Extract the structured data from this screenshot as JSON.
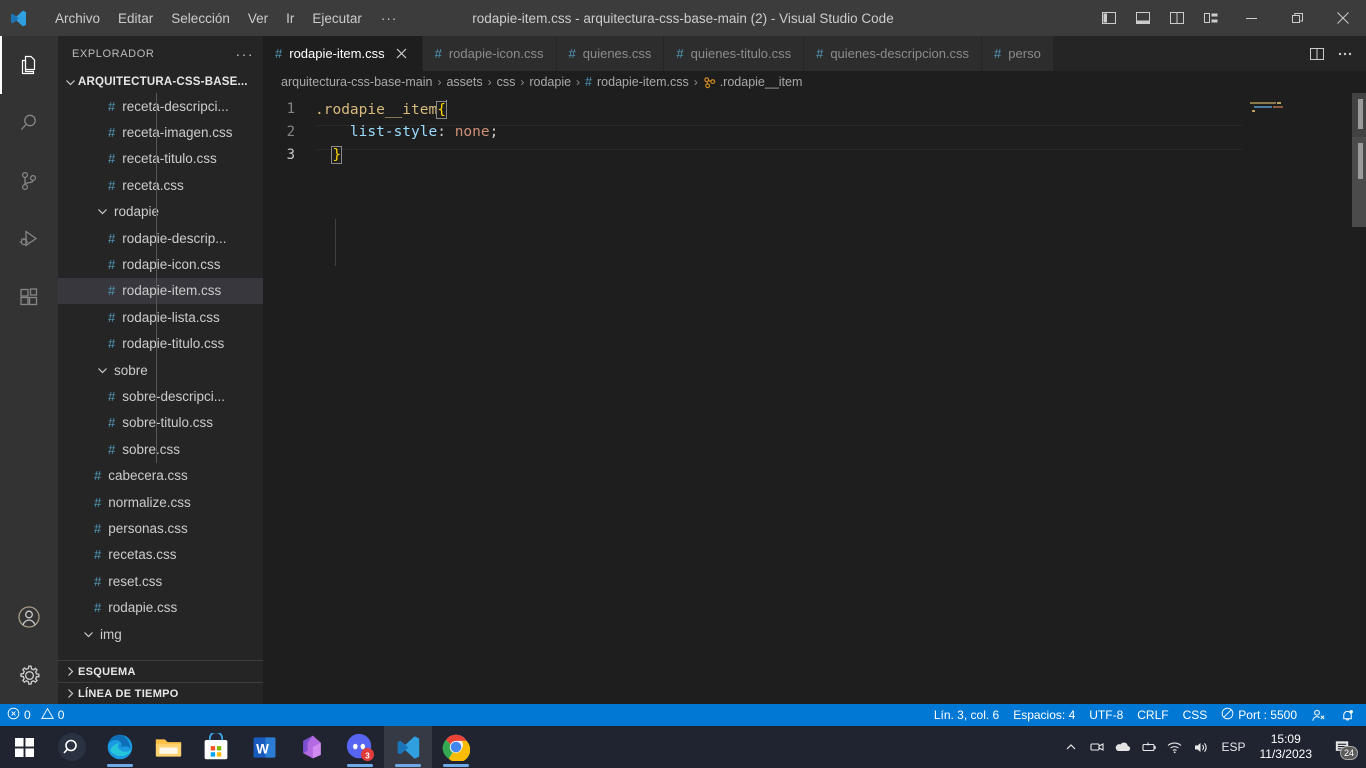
{
  "titlebar": {
    "logo_icon": "vscode-logo-icon",
    "menus": [
      "Archivo",
      "Editar",
      "Selección",
      "Ver",
      "Ir",
      "Ejecutar",
      "···"
    ],
    "title": "rodapie-item.css - arquitectura-css-base-main (2) - Visual Studio Code",
    "layout_icons": [
      "toggle-primary-sidebar-icon",
      "toggle-panel-icon",
      "toggle-secondary-sidebar-icon",
      "customize-layout-icon"
    ],
    "window_controls": [
      "minimize-button",
      "restore-button",
      "close-button"
    ]
  },
  "activitybar": {
    "items": [
      {
        "name": "explorer",
        "icon": "files-icon",
        "active": true
      },
      {
        "name": "search",
        "icon": "search-icon",
        "active": false
      },
      {
        "name": "source-control",
        "icon": "source-control-icon",
        "active": false
      },
      {
        "name": "run-and-debug",
        "icon": "run-debug-icon",
        "active": false
      },
      {
        "name": "extensions",
        "icon": "extensions-icon",
        "active": false
      }
    ],
    "bottom": [
      {
        "name": "accounts",
        "icon": "account-icon"
      },
      {
        "name": "manage-settings",
        "icon": "gear-icon"
      }
    ]
  },
  "sidebar": {
    "title": "EXPLORADOR",
    "more_actions": "···",
    "root_folder": "ARQUITECTURA-CSS-BASE...",
    "tree": [
      {
        "label": "receta-descripci...",
        "type": "file",
        "indent": 3,
        "selected": false
      },
      {
        "label": "receta-imagen.css",
        "type": "file",
        "indent": 3,
        "selected": false
      },
      {
        "label": "receta-titulo.css",
        "type": "file",
        "indent": 3,
        "selected": false
      },
      {
        "label": "receta.css",
        "type": "file",
        "indent": 3,
        "selected": false
      },
      {
        "label": "rodapie",
        "type": "folder-open",
        "indent": 2,
        "selected": false
      },
      {
        "label": "rodapie-descrip...",
        "type": "file",
        "indent": 3,
        "selected": false
      },
      {
        "label": "rodapie-icon.css",
        "type": "file",
        "indent": 3,
        "selected": false
      },
      {
        "label": "rodapie-item.css",
        "type": "file",
        "indent": 3,
        "selected": true
      },
      {
        "label": "rodapie-lista.css",
        "type": "file",
        "indent": 3,
        "selected": false
      },
      {
        "label": "rodapie-titulo.css",
        "type": "file",
        "indent": 3,
        "selected": false
      },
      {
        "label": "sobre",
        "type": "folder-open",
        "indent": 2,
        "selected": false
      },
      {
        "label": "sobre-descripci...",
        "type": "file",
        "indent": 3,
        "selected": false
      },
      {
        "label": "sobre-titulo.css",
        "type": "file",
        "indent": 3,
        "selected": false
      },
      {
        "label": "sobre.css",
        "type": "file",
        "indent": 3,
        "selected": false
      },
      {
        "label": "cabecera.css",
        "type": "file",
        "indent": 2,
        "selected": false
      },
      {
        "label": "normalize.css",
        "type": "file",
        "indent": 2,
        "selected": false
      },
      {
        "label": "personas.css",
        "type": "file",
        "indent": 2,
        "selected": false
      },
      {
        "label": "recetas.css",
        "type": "file",
        "indent": 2,
        "selected": false
      },
      {
        "label": "reset.css",
        "type": "file",
        "indent": 2,
        "selected": false
      },
      {
        "label": "rodapie.css",
        "type": "file",
        "indent": 2,
        "selected": false
      },
      {
        "label": "img",
        "type": "folder-open",
        "indent": 1,
        "selected": false
      }
    ],
    "panels": [
      {
        "label": "ESQUEMA",
        "collapsed": true
      },
      {
        "label": "LÍNEA DE TIEMPO",
        "collapsed": true
      }
    ]
  },
  "editor": {
    "tabs": [
      {
        "label": "rodapie-item.css",
        "icon": "css-file-icon",
        "active": true,
        "closable": true
      },
      {
        "label": "rodapie-icon.css",
        "icon": "css-file-icon",
        "active": false,
        "closable": false
      },
      {
        "label": "quienes.css",
        "icon": "css-file-icon",
        "active": false,
        "closable": false
      },
      {
        "label": "quienes-titulo.css",
        "icon": "css-file-icon",
        "active": false,
        "closable": false
      },
      {
        "label": "quienes-descripcion.css",
        "icon": "css-file-icon",
        "active": false,
        "closable": false
      },
      {
        "label": "perso",
        "icon": "css-file-icon",
        "active": false,
        "closable": false
      }
    ],
    "tab_actions": [
      "split-editor-icon",
      "more-actions-icon"
    ],
    "breadcrumbs": [
      {
        "label": "arquitectura-css-base-main",
        "icon": null
      },
      {
        "label": "assets",
        "icon": null
      },
      {
        "label": "css",
        "icon": null
      },
      {
        "label": "rodapie",
        "icon": null
      },
      {
        "label": "rodapie-item.css",
        "icon": "css-file-icon"
      },
      {
        "label": ".rodapie__item",
        "icon": "css-selector-icon"
      }
    ],
    "breadcrumb_separator": "›",
    "lines": [
      {
        "num": "1",
        "tokens": [
          {
            "t": ".rodapie__item",
            "c": "tok-sel"
          },
          {
            "t": "{",
            "c": "tok-brace bracket-match"
          }
        ]
      },
      {
        "num": "2",
        "tokens": [
          {
            "t": "    ",
            "c": ""
          },
          {
            "t": "list-style",
            "c": "tok-prop"
          },
          {
            "t": ":",
            "c": "tok-colon"
          },
          {
            "t": " ",
            "c": ""
          },
          {
            "t": "none",
            "c": "tok-val"
          },
          {
            "t": ";",
            "c": "tok-colon"
          }
        ]
      },
      {
        "num": "3",
        "tokens": [
          {
            "t": "  ",
            "c": ""
          },
          {
            "t": "}",
            "c": "tok-brace bracket-match"
          }
        ]
      }
    ],
    "cursor_line": 3
  },
  "statusbar": {
    "problems": {
      "errors_icon": "error-icon",
      "errors": "0",
      "warnings_icon": "warning-icon",
      "warnings": "0"
    },
    "right_items": [
      {
        "name": "cursor-position",
        "label": "Lín. 3, col. 6"
      },
      {
        "name": "indentation",
        "label": "Espacios: 4"
      },
      {
        "name": "encoding",
        "label": "UTF-8"
      },
      {
        "name": "end-of-line",
        "label": "CRLF"
      },
      {
        "name": "language-mode",
        "label": "CSS"
      },
      {
        "name": "live-server-port",
        "label": "Port : 5500",
        "icon": "port-icon"
      }
    ],
    "remote_icon": "remote-window-icon",
    "bell_icon": "bell-dot-icon",
    "accent_color": "#0078d4"
  },
  "taskbar": {
    "items": [
      {
        "name": "start",
        "icon": "windows-start-icon",
        "running": false,
        "focused": false
      },
      {
        "name": "search",
        "icon": "taskbar-search-icon",
        "running": false,
        "focused": false
      },
      {
        "name": "microsoft-edge",
        "icon": "edge-icon",
        "running": true,
        "focused": false
      },
      {
        "name": "file-explorer",
        "icon": "folder-icon",
        "running": false,
        "focused": false
      },
      {
        "name": "microsoft-store",
        "icon": "store-icon",
        "running": false,
        "focused": false
      },
      {
        "name": "microsoft-word",
        "icon": "word-icon",
        "running": false,
        "focused": false
      },
      {
        "name": "microsoft-365",
        "icon": "office-icon",
        "running": false,
        "focused": false
      },
      {
        "name": "discord",
        "icon": "discord-icon",
        "running": true,
        "focused": false,
        "badge": "3"
      },
      {
        "name": "visual-studio-code",
        "icon": "vscode-icon",
        "running": true,
        "focused": true
      },
      {
        "name": "google-chrome",
        "icon": "chrome-icon",
        "running": true,
        "focused": false
      }
    ],
    "tray": {
      "overflow_icon": "chevron-up-icon",
      "icons": [
        "camera-privacy-icon",
        "onedrive-icon",
        "battery-charging-icon",
        "wifi-icon",
        "volume-icon"
      ],
      "language": "ESP",
      "time": "15:09",
      "date": "11/3/2023",
      "notifications_icon": "notifications-icon",
      "notifications_count": "24"
    }
  }
}
